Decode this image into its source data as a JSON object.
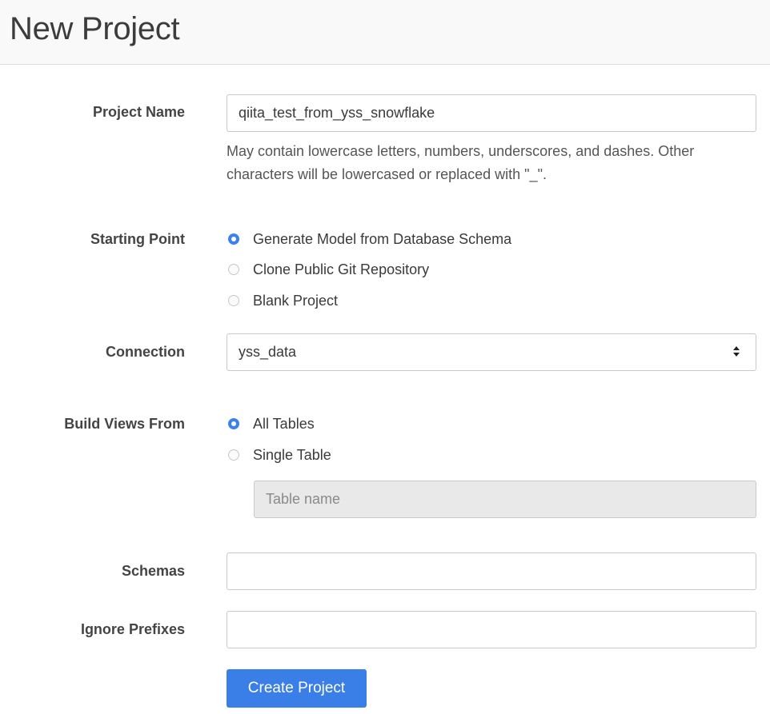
{
  "header": {
    "title": "New Project"
  },
  "form": {
    "project_name": {
      "label": "Project Name",
      "value": "qiita_test_from_yss_snowflake",
      "help": "May contain lowercase letters, numbers, underscores, and dashes. Other characters will be lowercased or replaced with \"_\"."
    },
    "starting_point": {
      "label": "Starting Point",
      "options": [
        {
          "label": "Generate Model from Database Schema",
          "checked": true
        },
        {
          "label": "Clone Public Git Repository",
          "checked": false
        },
        {
          "label": "Blank Project",
          "checked": false
        }
      ]
    },
    "connection": {
      "label": "Connection",
      "selected": "yss_data"
    },
    "build_views_from": {
      "label": "Build Views From",
      "options": [
        {
          "label": "All Tables",
          "checked": true
        },
        {
          "label": "Single Table",
          "checked": false
        }
      ],
      "table_name_placeholder": "Table name"
    },
    "schemas": {
      "label": "Schemas",
      "value": ""
    },
    "ignore_prefixes": {
      "label": "Ignore Prefixes",
      "value": ""
    },
    "submit_label": "Create Project"
  },
  "colors": {
    "accent": "#3a7ee8",
    "radio_checked": "#3b82f0",
    "header_bg": "#f9f9f9"
  }
}
